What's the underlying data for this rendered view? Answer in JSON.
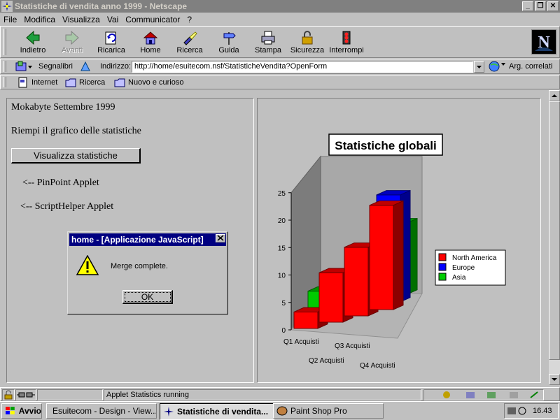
{
  "window": {
    "title": "Statistiche di vendita anno 1999 - Netscape",
    "controls": [
      "_",
      "❐",
      "✕"
    ]
  },
  "menu": [
    "File",
    "Modifica",
    "Visualizza",
    "Vai",
    "Communicator",
    "?"
  ],
  "toolbar": {
    "buttons": [
      {
        "label": "Indietro",
        "icon": "back-arrow-icon"
      },
      {
        "label": "Avanti",
        "icon": "forward-arrow-icon",
        "disabled": true
      },
      {
        "label": "Ricarica",
        "icon": "reload-icon"
      },
      {
        "label": "Home",
        "icon": "home-icon"
      },
      {
        "label": "Ricerca",
        "icon": "search-flashlight-icon"
      },
      {
        "label": "Guida",
        "icon": "guide-signpost-icon"
      },
      {
        "label": "Stampa",
        "icon": "printer-icon"
      },
      {
        "label": "Sicurezza",
        "icon": "padlock-icon"
      },
      {
        "label": "Interrompi",
        "icon": "stop-icon"
      }
    ]
  },
  "location": {
    "bookmarks_label": "Segnalibri",
    "address_label": "Indirizzo:",
    "url": "http://home/esuitecom.nsf/StatisticheVendita?OpenForm",
    "related_label": "Arg. correlati"
  },
  "personal_toolbar": [
    "Internet",
    "Ricerca",
    "Nuovo e curioso"
  ],
  "page": {
    "heading": "Mokabyte Settembre 1999",
    "instruction": "Riempi il grafico delle statistiche",
    "stats_button": "Visualizza statistiche",
    "pinpoint_note": "<-- PinPoint Applet",
    "scripthelper_note": "<-- ScriptHelper Applet"
  },
  "dialog": {
    "title": "home - [Applicazione JavaScript]",
    "message": "Merge complete.",
    "ok": "OK"
  },
  "chart_data": {
    "type": "bar",
    "title": "Statistiche globali",
    "categories": [
      "Q1 Acquisti",
      "Q2 Acquisti",
      "Q3 Acquisti",
      "Q4 Acquisti"
    ],
    "series": [
      {
        "name": "North America",
        "color": "#ff0000",
        "values": [
          3,
          9,
          12.5,
          19
        ]
      },
      {
        "name": "Europe",
        "color": "#0000ff",
        "values": [
          1,
          7,
          8,
          19.5
        ]
      },
      {
        "name": "Asia",
        "color": "#00cc00",
        "values": [
          4,
          4.5,
          6.5,
          13
        ]
      }
    ],
    "y_ticks": [
      "0",
      "5",
      "10",
      "15",
      "20",
      "25"
    ],
    "ylim": [
      0,
      25
    ],
    "legend": "right",
    "style": "3d"
  },
  "status": {
    "text": "Applet Statistics running"
  },
  "taskbar": {
    "start": "Avvio",
    "tasks": [
      {
        "label": "Esuitecom - Design - View...",
        "active": false
      },
      {
        "label": "Statistiche di vendita...",
        "active": true
      },
      {
        "label": "Paint Shop Pro",
        "active": false
      }
    ],
    "clock": "16.43"
  }
}
